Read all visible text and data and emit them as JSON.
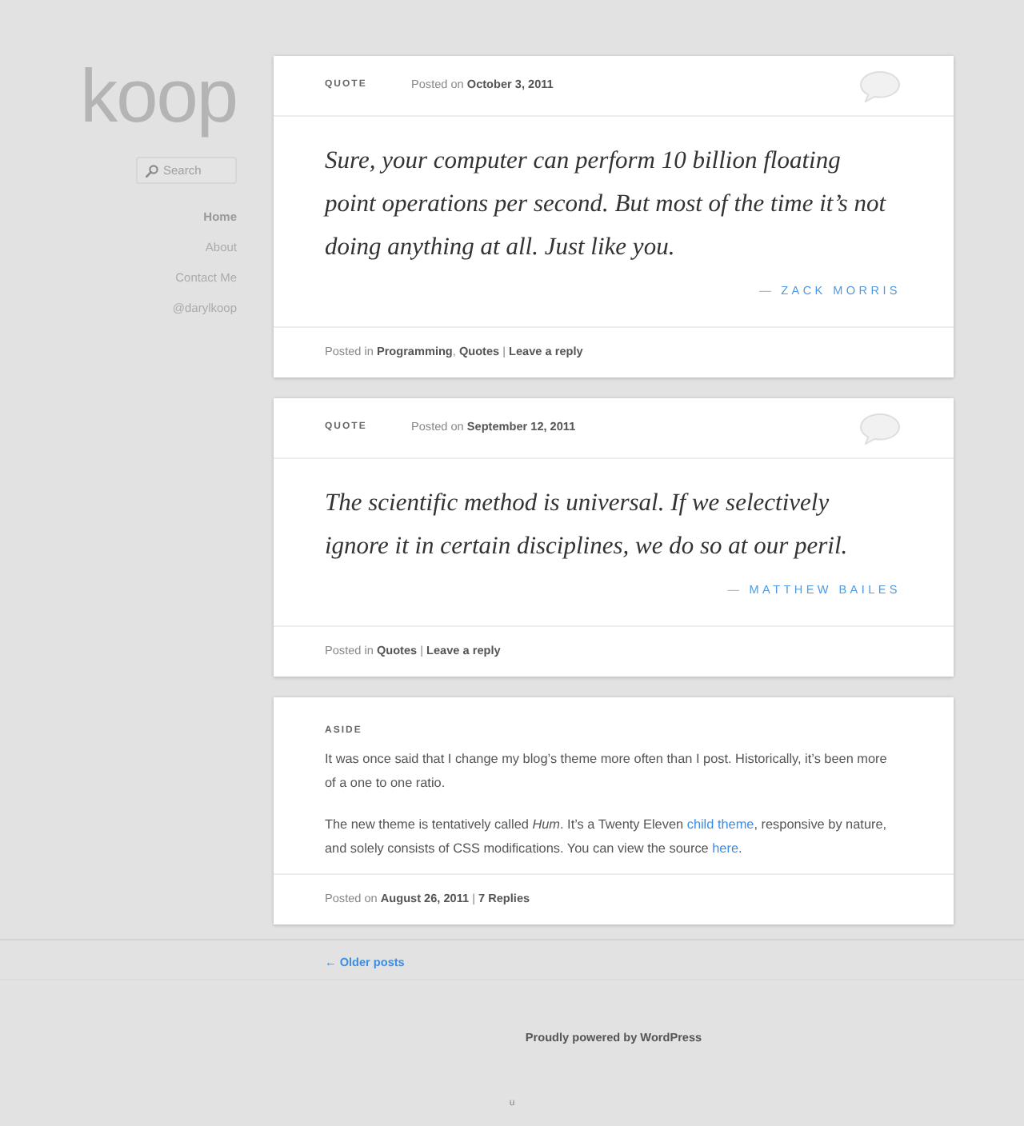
{
  "sidebar": {
    "logo": "koop",
    "search": {
      "placeholder": "Search"
    },
    "nav": [
      {
        "label": "Home",
        "selected": true
      },
      {
        "label": "About",
        "selected": false
      },
      {
        "label": "Contact Me",
        "selected": false
      },
      {
        "label": "@darylkoop",
        "selected": false
      }
    ]
  },
  "posts": [
    {
      "kind": "quote",
      "format": "QUOTE",
      "meta": [
        {
          "kind": "text",
          "text": "Posted on "
        },
        {
          "kind": "link",
          "text": "October 3, 2011"
        }
      ],
      "quote": "Sure, your computer can perform 10 billion floating point operations per second. But most of the time it’s not doing anything at all. Just like you.",
      "attribution": {
        "dash": "—",
        "name": "ZACK MORRIS"
      },
      "footer": [
        {
          "kind": "text",
          "text": "Posted in "
        },
        {
          "kind": "link",
          "text": "Programming"
        },
        {
          "kind": "text",
          "text": ", "
        },
        {
          "kind": "link",
          "text": "Quotes"
        },
        {
          "kind": "text",
          "text": " | "
        },
        {
          "kind": "link",
          "text": "Leave a reply"
        }
      ]
    },
    {
      "kind": "quote",
      "format": "QUOTE",
      "meta": [
        {
          "kind": "text",
          "text": "Posted on "
        },
        {
          "kind": "link",
          "text": "September 12, 2011"
        }
      ],
      "quote": "The scientific method is universal. If we selectively ignore it in certain disciplines, we do so at our peril.",
      "attribution": {
        "dash": "—",
        "name": "MATTHEW BAILES"
      },
      "footer": [
        {
          "kind": "text",
          "text": "Posted in "
        },
        {
          "kind": "link",
          "text": "Quotes"
        },
        {
          "kind": "text",
          "text": " | "
        },
        {
          "kind": "link",
          "text": "Leave a reply"
        }
      ]
    },
    {
      "kind": "aside",
      "format": "ASIDE",
      "paragraphs": [
        [
          {
            "kind": "text",
            "text": "It was once said that I change my blog’s theme more often than I post. Historically, it’s been more of a one to one ratio."
          }
        ],
        [
          {
            "kind": "text",
            "text": "The new theme is tentatively called *Hum*. It’s a Twenty Eleven "
          },
          {
            "kind": "link",
            "text": "child theme"
          },
          {
            "kind": "text",
            "text": ", responsive by nature, and solely consists of CSS modifications. You can view the source "
          },
          {
            "kind": "link",
            "text": "here"
          },
          {
            "kind": "text",
            "text": "."
          }
        ]
      ],
      "footer": [
        {
          "kind": "text",
          "text": "Posted on "
        },
        {
          "kind": "link",
          "text": "August 26, 2011"
        },
        {
          "kind": "text",
          "text": " | "
        },
        {
          "kind": "link",
          "text": "7 Replies"
        }
      ]
    }
  ],
  "pagination": {
    "older": "← Older posts"
  },
  "site_footer": {
    "credit": "Proudly powered by WordPress",
    "mark": "u"
  }
}
